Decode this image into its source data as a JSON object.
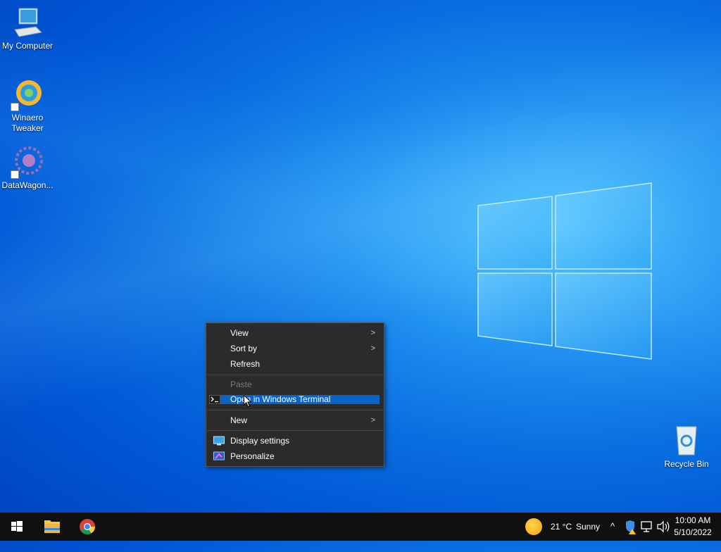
{
  "desktop": {
    "icons": [
      {
        "label": "My Computer",
        "icon": "computer-icon"
      },
      {
        "label": "Winaero Tweaker",
        "icon": "winaero-icon"
      },
      {
        "label": "DataWagon...",
        "icon": "datawagon-icon"
      },
      {
        "label": "Recycle Bin",
        "icon": "recycle-bin-icon"
      }
    ]
  },
  "context_menu": {
    "items": [
      {
        "label": "View",
        "has_submenu": true
      },
      {
        "label": "Sort by",
        "has_submenu": true
      },
      {
        "label": "Refresh"
      },
      {
        "label": "Paste",
        "disabled": true
      },
      {
        "label": "Open in Windows Terminal",
        "icon": "terminal-icon",
        "highlighted": true
      },
      {
        "label": "New",
        "has_submenu": true
      },
      {
        "label": "Display settings",
        "icon": "display-icon"
      },
      {
        "label": "Personalize",
        "icon": "personalize-icon"
      }
    ],
    "chevron": ">"
  },
  "taskbar": {
    "pinned": [
      "start-icon",
      "file-explorer-icon",
      "chrome-icon"
    ],
    "weather": {
      "temp": "21 °C",
      "condition": "Sunny"
    },
    "tray_chevron": "^",
    "clock": {
      "time": "10:00 AM",
      "date": "5/10/2022"
    }
  },
  "colors": {
    "accent": "#0a64c8",
    "menu_bg": "#2b2b2b",
    "taskbar_bg": "#101010"
  }
}
